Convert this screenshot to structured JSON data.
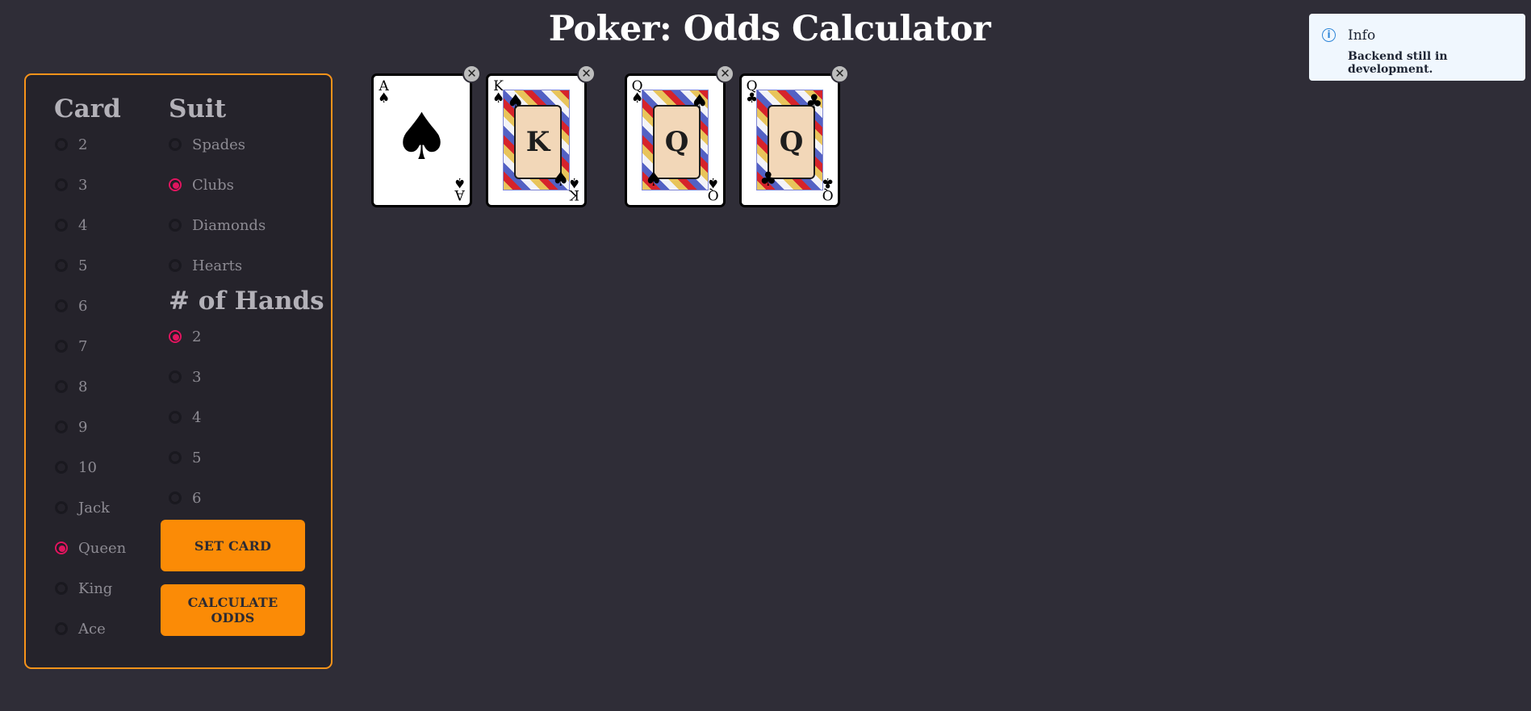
{
  "page": {
    "title": "Poker: Odds Calculator"
  },
  "card_column": {
    "heading": "Card",
    "options": [
      "2",
      "3",
      "4",
      "5",
      "6",
      "7",
      "8",
      "9",
      "10",
      "Jack",
      "Queen",
      "King",
      "Ace"
    ],
    "selected": "Queen"
  },
  "suit_column": {
    "heading": "Suit",
    "options": [
      "Spades",
      "Clubs",
      "Diamonds",
      "Hearts"
    ],
    "selected": "Clubs"
  },
  "hands_column": {
    "heading": "# of Hands",
    "options": [
      "2",
      "3",
      "4",
      "5",
      "6"
    ],
    "selected": "2"
  },
  "buttons": {
    "set_card": "SET CARD",
    "calculate_odds": "CALCULATE ODDS"
  },
  "hand_cards": [
    {
      "rank": "A",
      "suit": "♠",
      "suit_name": "spades",
      "face": false
    },
    {
      "rank": "K",
      "suit": "♠",
      "suit_name": "spades",
      "face": true
    },
    {
      "rank": "Q",
      "suit": "♠",
      "suit_name": "spades",
      "face": true
    },
    {
      "rank": "Q",
      "suit": "♣",
      "suit_name": "clubs",
      "face": true
    }
  ],
  "remove_icon": "close-icon",
  "toast": {
    "title": "Info",
    "message": "Backend still in development.",
    "icon": "info-icon"
  },
  "colors": {
    "accent": "#fb8b06",
    "radio_selected": "#e0155f",
    "background": "#2f2d37",
    "panel_border": "#f7931a"
  }
}
